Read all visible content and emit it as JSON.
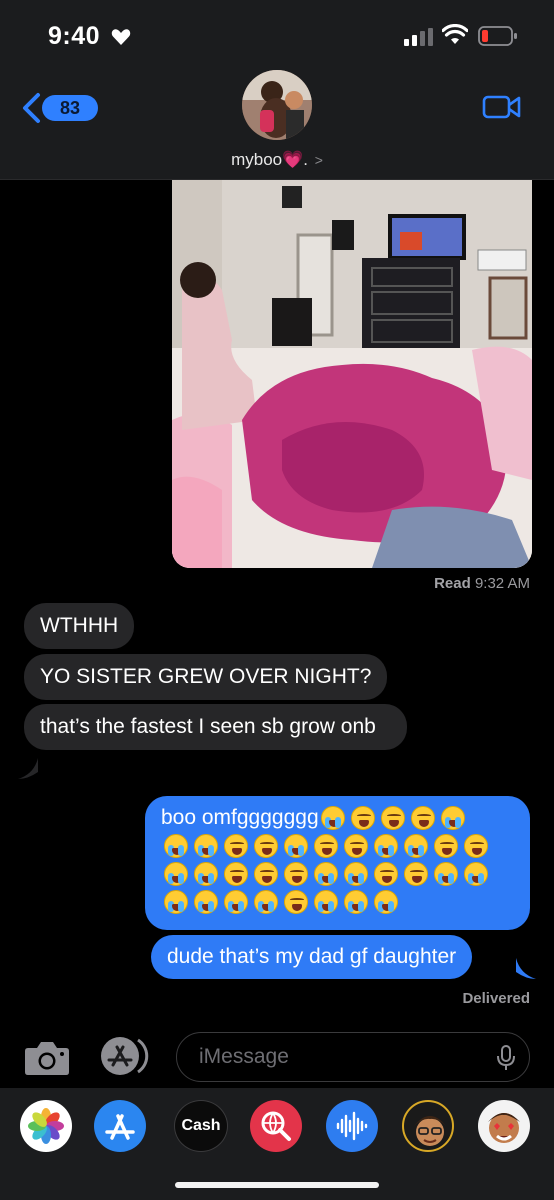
{
  "status_bar": {
    "time": "9:40"
  },
  "nav": {
    "back_count": "83",
    "contact_name": "myboo",
    "contact_suffix": "💗.",
    "chevron": ">"
  },
  "conversation": {
    "read_label": "Read",
    "read_time": "9:32 AM",
    "incoming": [
      {
        "text": "WTHHH"
      },
      {
        "text": "YO SISTER GREW OVER NIGHT?"
      },
      {
        "text": "that’s the fastest I seen sb grow onb"
      }
    ],
    "outgoing": [
      {
        "text": "boo omfggggggg"
      },
      {
        "text": "dude that’s my dad gf daughter"
      }
    ],
    "delivered": "Delivered"
  },
  "composer": {
    "placeholder": "iMessage"
  },
  "drawer": {
    "cash_label": "Cash"
  },
  "colors": {
    "outgoing_bubble": "#2f7bf6",
    "incoming_bubble": "#262628",
    "badge": "#2f80ff",
    "background": "#000000"
  }
}
